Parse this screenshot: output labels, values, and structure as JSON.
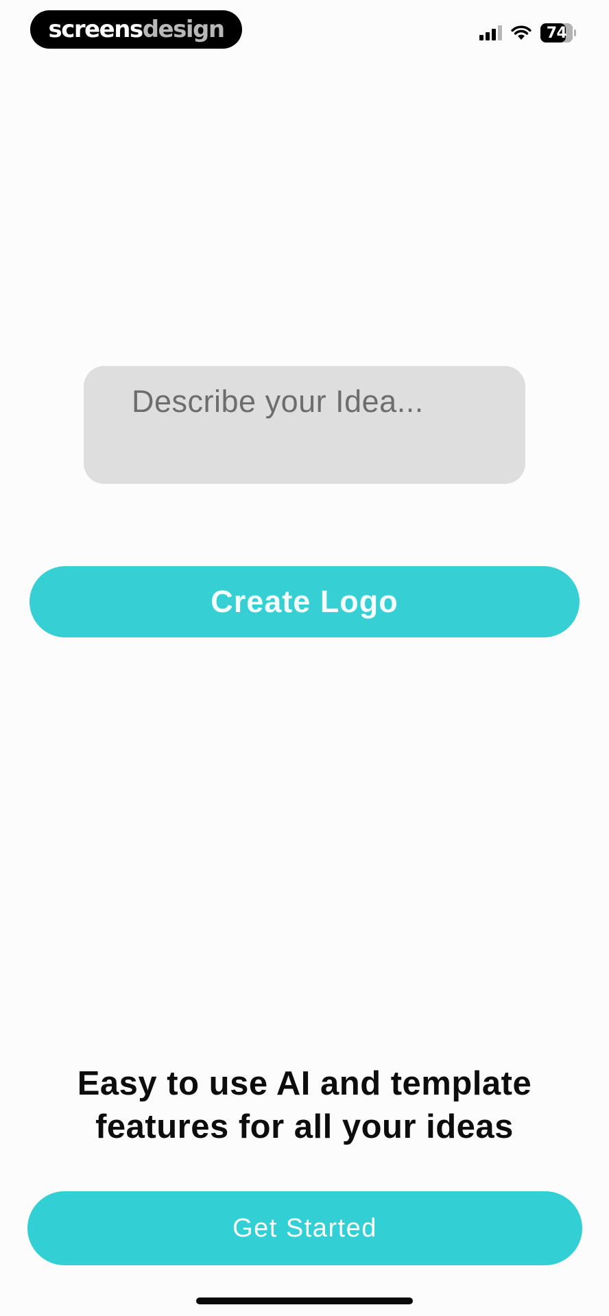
{
  "watermark": {
    "part1": "screens",
    "part2": "design"
  },
  "status_bar": {
    "battery_level": "74",
    "signal_icon": "cellular-signal-icon",
    "wifi_icon": "wifi-icon"
  },
  "prompt": {
    "placeholder": "Describe your Idea..."
  },
  "create_button": {
    "label": "Create Logo"
  },
  "headline": {
    "line1": "Easy to use AI and template",
    "line2": "features for all your ideas"
  },
  "cta": {
    "label": "Get Started"
  },
  "colors": {
    "accent": "#36cfd3",
    "input_bg": "#dededf",
    "background": "#fdfcfd"
  }
}
